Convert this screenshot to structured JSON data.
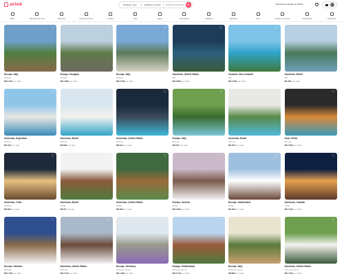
{
  "brand": {
    "name": "airbnb",
    "color": "#ff385c"
  },
  "search": {
    "where": "Qualquer lugar",
    "when": "Qualquer semana",
    "who": "Adicionar hóspedes"
  },
  "header": {
    "host_label": "Anuncie seu espaço no Airbnb"
  },
  "categories": [
    {
      "label": "Ilhas",
      "icon": "island-icon"
    },
    {
      "label": "Mansões de luxo",
      "icon": "mansion-icon"
    },
    {
      "label": "Piscinas",
      "icon": "pool-icon"
    },
    {
      "label": "Vistas incríveis",
      "icon": "view-icon"
    },
    {
      "label": "Chalés",
      "icon": "cabin-icon"
    },
    {
      "label": "Arte",
      "icon": "art-icon"
    },
    {
      "label": "Lagos",
      "icon": "lake-icon"
    },
    {
      "label": "Campismo",
      "icon": "camping-icon"
    },
    {
      "label": "Castelos",
      "icon": "castle-icon"
    },
    {
      "label": "Cabanas",
      "icon": "hut-icon"
    },
    {
      "label": "Surf",
      "icon": "surf-icon"
    },
    {
      "label": "Casas de campo",
      "icon": "countryside-icon"
    },
    {
      "label": "Tendências",
      "icon": "trending-icon"
    },
    {
      "label": "Mansões",
      "icon": "house-icon"
    }
  ],
  "listings": [
    {
      "location": "Europe, Italy",
      "sub": "Castelo",
      "price": "R$ 2.945",
      "unit": "por noite",
      "colors": [
        "#6f9fc9",
        "#4f7f3f",
        "#8a6a4a"
      ]
    },
    {
      "location": "Europe, Hungary",
      "sub": "Castelo",
      "price": "R$ 1.680",
      "unit": "por noite",
      "colors": [
        "#bcd0de",
        "#5f7a4a",
        "#6f6a60"
      ]
    },
    {
      "location": "Europe, Italy",
      "sub": "Castelo",
      "price": "R$ 3.790",
      "unit": "por noite",
      "colors": [
        "#7aa9d6",
        "#5a7a5a",
        "#d9d3c4"
      ]
    },
    {
      "location": "Americas, United States",
      "sub": "Ilha",
      "price": "R$ 2.890",
      "unit": "por noite",
      "colors": [
        "#1e3c5a",
        "#2b5f7c",
        "#3a5a3a"
      ]
    },
    {
      "location": "Oceania, New Zealand",
      "sub": "Ilha",
      "price": "R$ 4.360",
      "unit": "por noite",
      "colors": [
        "#7fc3e8",
        "#2fa3c9",
        "#3f7a3f"
      ]
    },
    {
      "location": "Americas, Brazil",
      "sub": "Ilha",
      "price": "R$ 450",
      "unit": "por noite",
      "colors": [
        "#b8cfe4",
        "#4a7a5a",
        "#6f9fb9"
      ]
    },
    {
      "location": "Americas, Argentina",
      "sub": "Piscina",
      "price": "R$ 730",
      "unit": "por noite",
      "colors": [
        "#8fc6e8",
        "#e8e8e4",
        "#3a8ab9"
      ]
    },
    {
      "location": "Americas, Brazil",
      "sub": "Piscina",
      "price": "R$ 890",
      "unit": "por noite",
      "colors": [
        "#d9e6ef",
        "#f2f2ee",
        "#2fa3c9"
      ]
    },
    {
      "location": "Americas, United States",
      "sub": "Piscina",
      "price": "R$ 910",
      "unit": "por noite",
      "colors": [
        "#1a2a3a",
        "#3a4a5a",
        "#3fb9d9"
      ]
    },
    {
      "location": "Europe, Italy",
      "sub": "Piscina",
      "price": "R$ 570",
      "unit": "por noite",
      "colors": [
        "#6f9f4f",
        "#3a6a2f",
        "#7ac9d9"
      ]
    },
    {
      "location": "Americas, Brazil",
      "sub": "Piscina",
      "price": "R$ 700",
      "unit": "por noite",
      "colors": [
        "#e8e8e4",
        "#5a8a4a",
        "#4fb9d9"
      ]
    },
    {
      "location": "Asia, China",
      "sub": "Piscina",
      "price": "R$ 1.550",
      "unit": "por noite",
      "colors": [
        "#2a2a2a",
        "#d98a3a",
        "#3a9ab9"
      ]
    },
    {
      "location": "Americas, Chile",
      "sub": "Cabana",
      "price": "R$ 300",
      "unit": "por noite",
      "colors": [
        "#1e2a3a",
        "#e8c080",
        "#6a4a30"
      ]
    },
    {
      "location": "Americas, Brazil",
      "sub": "Chalé",
      "price": "R$ 35",
      "unit": "por noite",
      "colors": [
        "#f2f2f2",
        "#8a5a3a",
        "#4f7a3f"
      ]
    },
    {
      "location": "Americas, United States",
      "sub": "Chalé",
      "price": "R$ 480",
      "unit": "por noite",
      "colors": [
        "#3f6a3f",
        "#9a6a3a",
        "#5a8a4a"
      ]
    },
    {
      "location": "Europe, Austria",
      "sub": "Chalé",
      "price": "R$ 2.999",
      "unit": "por noite",
      "colors": [
        "#c9b9c9",
        "#7a5a4a",
        "#f2f2f2"
      ]
    },
    {
      "location": "Europe, Switzerland",
      "sub": "Chalé",
      "price": "R$ 460",
      "unit": "por noite",
      "colors": [
        "#9fbfdf",
        "#ffffff",
        "#6a4a3a"
      ]
    },
    {
      "location": "Americas, Canada",
      "sub": "Chalé",
      "price": "R$ 1.045",
      "unit": "por noite",
      "colors": [
        "#0f1f3f",
        "#e8a050",
        "#5a3a2a"
      ]
    },
    {
      "location": "Europe, Sweden",
      "sub": "Mansão",
      "price": "R$ 4.150",
      "unit": "por noite",
      "colors": [
        "#2f4f8f",
        "#8a6a4a",
        "#f2f2f2"
      ]
    },
    {
      "location": "Americas, United States",
      "sub": "Mansão",
      "price": "R$ 2.510",
      "unit": "por noite",
      "colors": [
        "#a9b9c9",
        "#6a4a3a",
        "#f0f0f0"
      ]
    },
    {
      "location": "Europe, Germany",
      "sub": "Casa de campo",
      "price": "R$ 1.320",
      "unit": "por noite",
      "colors": [
        "#dfe8ef",
        "#9a9a8a",
        "#8a6ab9"
      ]
    },
    {
      "location": "Europe, Switzerland",
      "sub": "Casa de campo",
      "price": "R$ 2.410",
      "unit": "por noite",
      "colors": [
        "#b9d4ef",
        "#9a5a3a",
        "#4f7a3f"
      ]
    },
    {
      "location": "Europe, Italy",
      "sub": "Casa de campo",
      "price": "R$ 890",
      "unit": "por noite",
      "colors": [
        "#e8e4d0",
        "#5a7a3a",
        "#c9a070"
      ]
    },
    {
      "location": "Americas, United States",
      "sub": "Casa de campo",
      "price": "R$ 1.760",
      "unit": "por noite",
      "colors": [
        "#6f9f4f",
        "#f2f2ee",
        "#3a5a3a"
      ]
    }
  ]
}
